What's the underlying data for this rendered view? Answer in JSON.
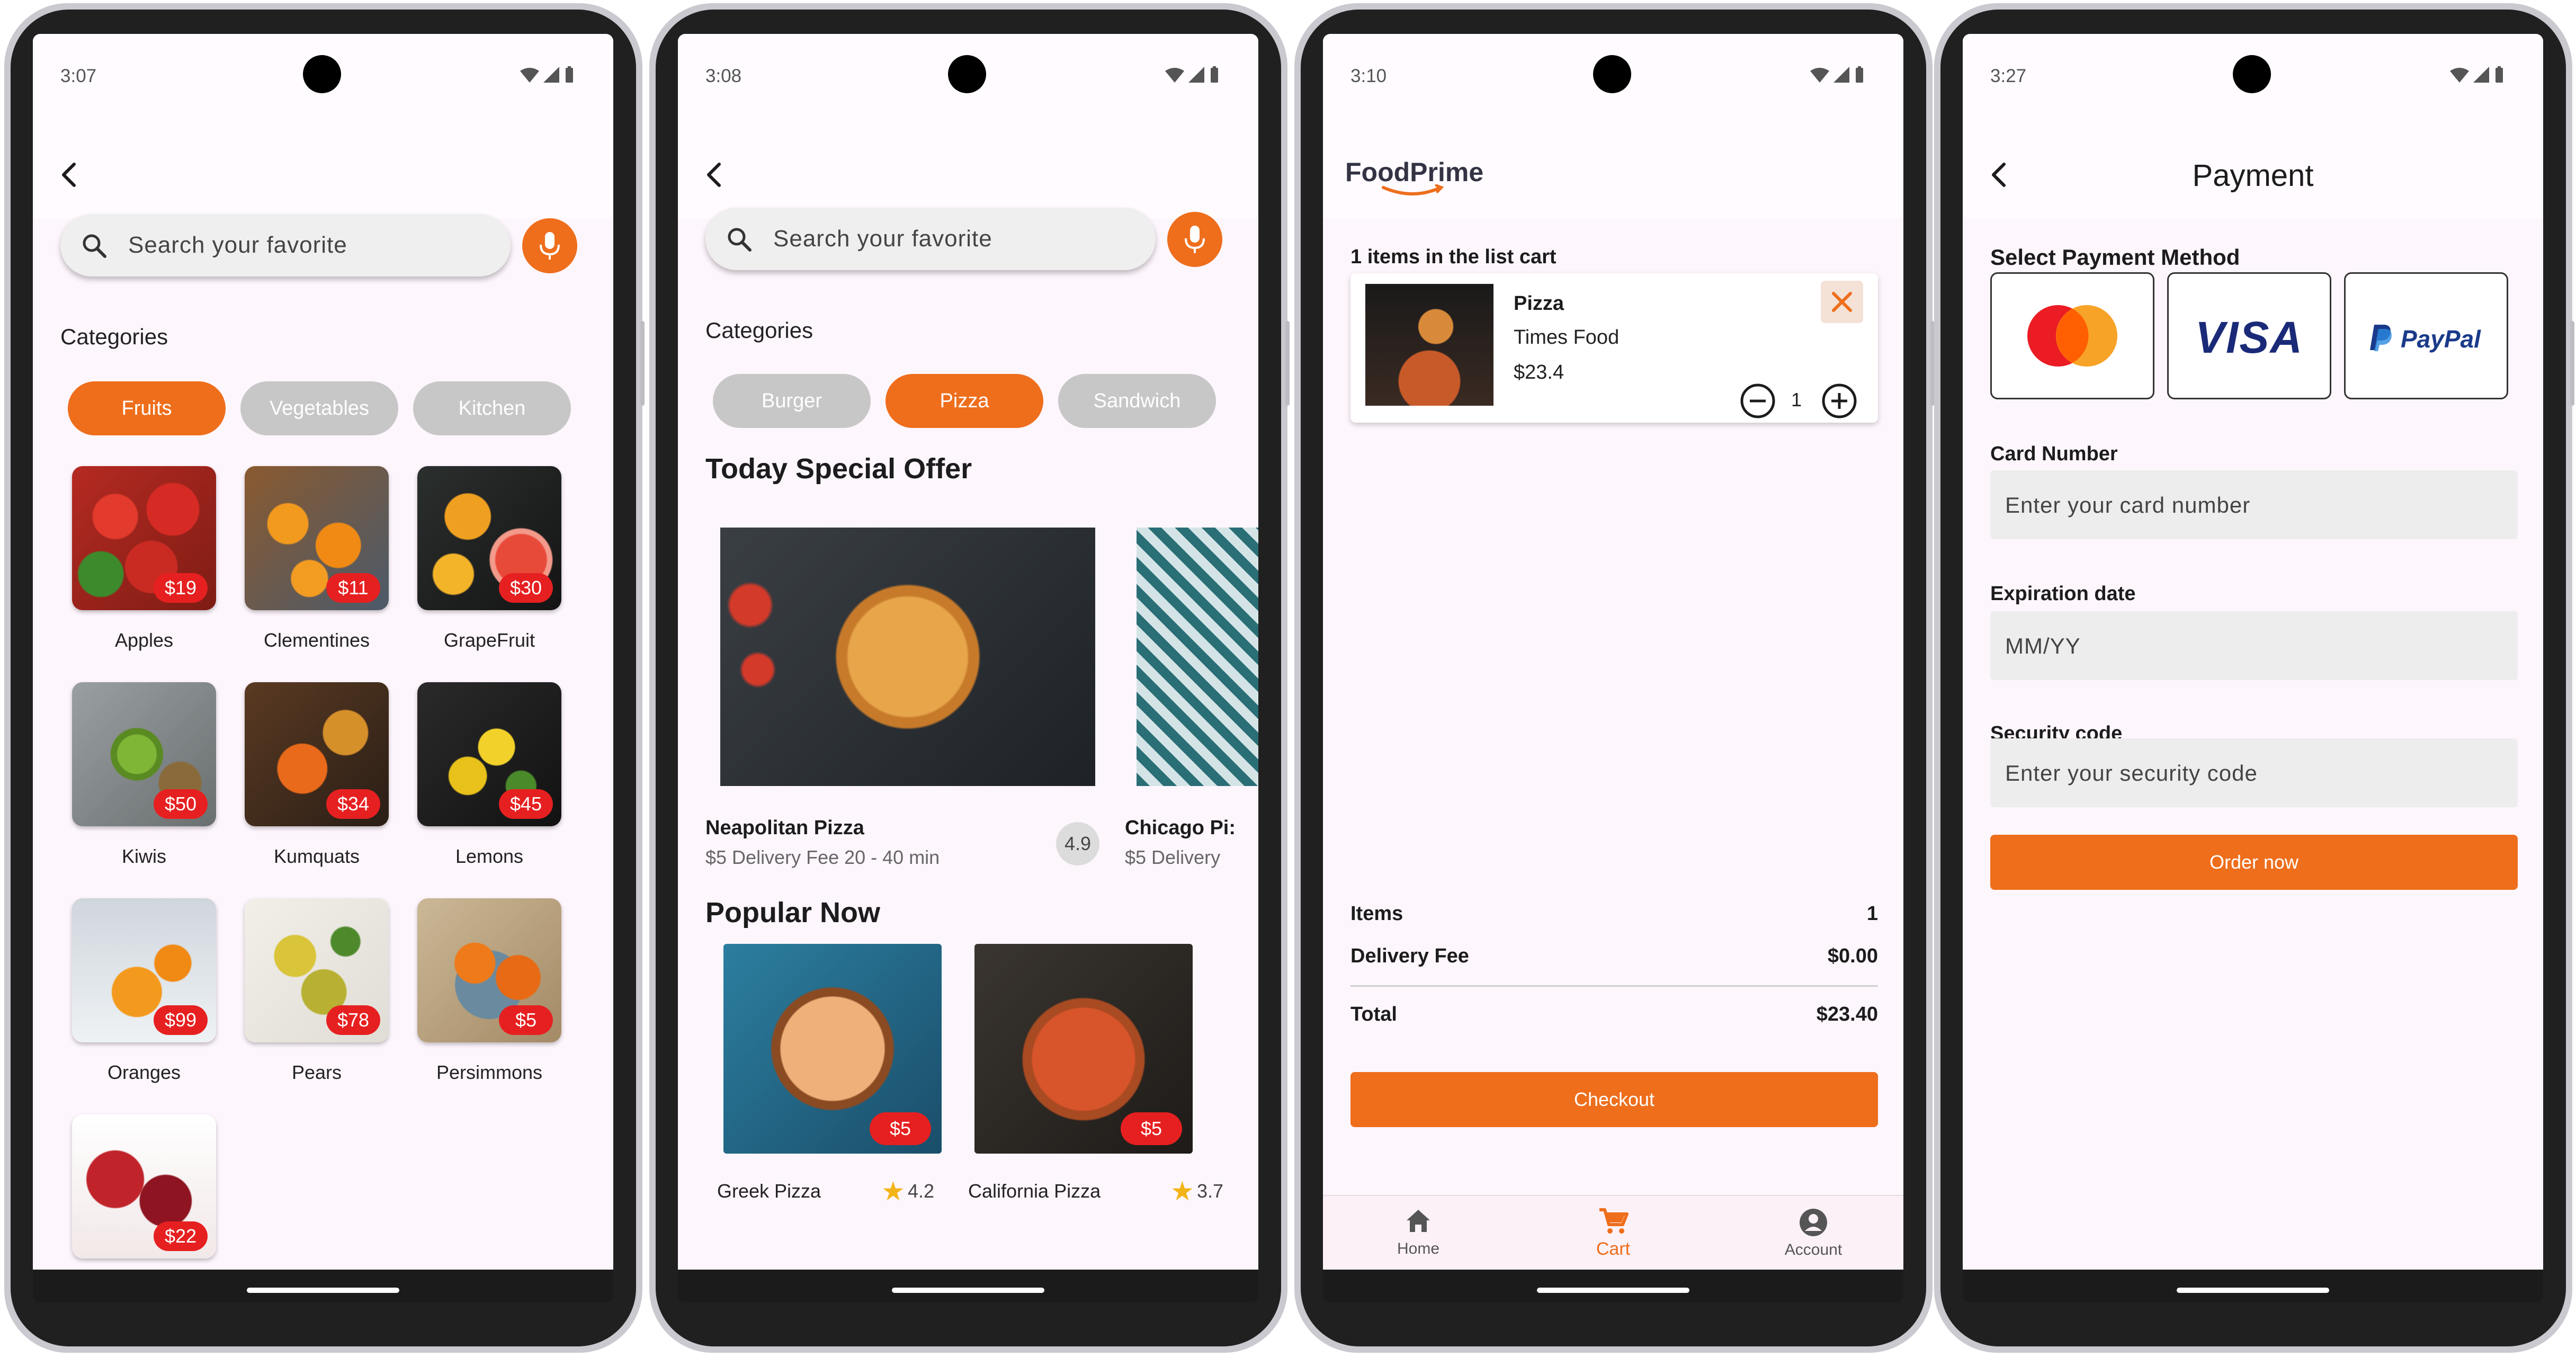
{
  "colors": {
    "accent": "#ee6e1c",
    "badge": "#e62020",
    "chip_inactive": "#c7c7c7",
    "background": "#fef6fd"
  },
  "screen1": {
    "time": "3:07",
    "search_placeholder": "Search your favorite",
    "categories_title": "Categories",
    "chips": [
      "Fruits",
      "Vegetables",
      "Kitchen"
    ],
    "fruits": [
      {
        "name": "Apples",
        "price": "$19"
      },
      {
        "name": "Clementines",
        "price": "$11"
      },
      {
        "name": "GrapeFruit",
        "price": "$30"
      },
      {
        "name": "Kiwis",
        "price": "$50"
      },
      {
        "name": "Kumquats",
        "price": "$34"
      },
      {
        "name": "Lemons",
        "price": "$45"
      },
      {
        "name": "Oranges",
        "price": "$99"
      },
      {
        "name": "Pears",
        "price": "$78"
      },
      {
        "name": "Persimmons",
        "price": "$5"
      },
      {
        "name": "",
        "price": "$22"
      }
    ]
  },
  "screen2": {
    "time": "3:08",
    "search_placeholder": "Search your favorite",
    "categories_title": "Categories",
    "chips": [
      "Burger",
      "Pizza",
      "Sandwich"
    ],
    "special_title": "Today Special Offer",
    "specials": [
      {
        "name": "Neapolitan Pizza",
        "sub": "$5 Delivery Fee 20 - 40 min",
        "rating": "4.9"
      },
      {
        "name": "Chicago Pi:",
        "sub": "$5 Delivery"
      }
    ],
    "popular_title": "Popular Now",
    "popular": [
      {
        "name": "Greek Pizza",
        "price": "$5",
        "rating": "4.2"
      },
      {
        "name": "California Pizza",
        "price": "$5",
        "rating": "3.7"
      }
    ]
  },
  "screen3": {
    "time": "3:10",
    "logo": "FoodPrime",
    "cart_count_text": "1 items in the list cart",
    "item": {
      "name": "Pizza",
      "restaurant": "Times Food",
      "price": "$23.4",
      "qty": "1"
    },
    "summary": {
      "items_label": "Items",
      "items_value": "1",
      "fee_label": "Delivery Fee",
      "fee_value": "$0.00",
      "total_label": "Total",
      "total_value": "$23.40"
    },
    "checkout_label": "Checkout",
    "nav": [
      "Home",
      "Cart",
      "Account"
    ]
  },
  "screen4": {
    "time": "3:27",
    "title": "Payment",
    "method_title": "Select Payment Method",
    "visa_text": "VISA",
    "paypal_text": "PayPal",
    "card_label": "Card Number",
    "card_placeholder": "Enter your card number",
    "exp_label": "Expiration date",
    "exp_placeholder": "MM/YY",
    "sec_label": "Security code",
    "sec_placeholder": "Enter your security code",
    "order_label": "Order now"
  }
}
